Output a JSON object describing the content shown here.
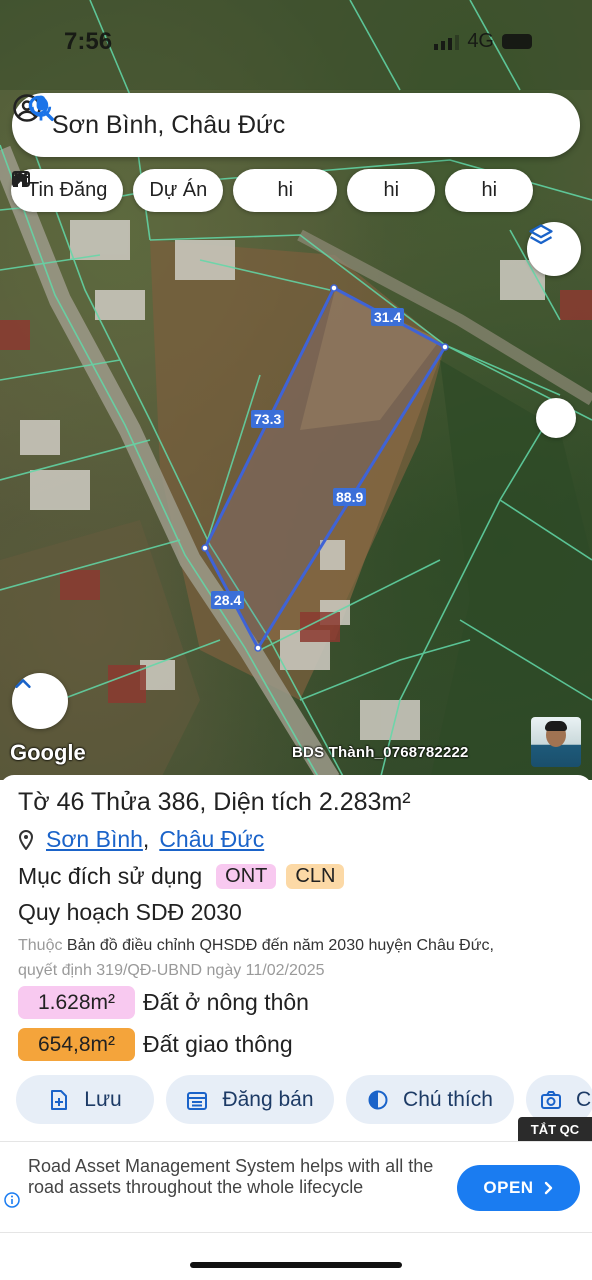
{
  "status": {
    "time": "7:56",
    "network": "4G"
  },
  "search": {
    "query": "Sơn Bình, Châu Đức"
  },
  "chips": [
    {
      "icon": "listing-icon",
      "label": "Tin Đăng"
    },
    {
      "icon": "building-icon",
      "label": "Dự Án"
    },
    {
      "icon": "tools-icon",
      "label": "hi"
    },
    {
      "icon": "tools-icon",
      "label": "hi"
    },
    {
      "icon": "tools-icon",
      "label": "hi"
    }
  ],
  "map": {
    "segments": [
      "31.4",
      "73.3",
      "88.9",
      "28.4"
    ],
    "logo": "Google",
    "credit": "BDS Thành_0768782222",
    "parcel_color": "#3f63d6"
  },
  "parcel": {
    "title": "Tờ 46 Thửa 386, Diện tích 2.283m²",
    "ward": "Sơn Bình",
    "separator": ",",
    "district": "Châu Đức",
    "purpose_label": "Mục đích sử dụng",
    "purpose_tags": [
      "ONT",
      "CLN"
    ],
    "plan_title": "Quy hoạch SDĐ 2030",
    "plan_prefix": "Thuộc",
    "plan_source": "Bản đồ điều chỉnh QHSDĐ đến năm 2030 huyện Châu Đức,",
    "plan_decision": "quyết định 319/QĐ-UBND ngày 11/02/2025",
    "areas": [
      {
        "value": "1.628m²",
        "label": "Đất ở nông thôn",
        "color": "#f8c9f0"
      },
      {
        "value": "654,8m²",
        "label": "Đất giao thông",
        "color": "#f4a43b"
      }
    ]
  },
  "actions": [
    {
      "icon": "save-icon",
      "label": "Lưu"
    },
    {
      "icon": "calendar-icon",
      "label": "Đăng bán"
    },
    {
      "icon": "legend-icon",
      "label": "Chú thích"
    },
    {
      "icon": "camera-icon",
      "label": "C"
    }
  ],
  "ad": {
    "hide_label": "TẮT QC",
    "text": "Road Asset Management System helps with all the road assets throughout the whole lifecycle",
    "cta": "OPEN",
    "cta_color": "#1a7cf1"
  }
}
